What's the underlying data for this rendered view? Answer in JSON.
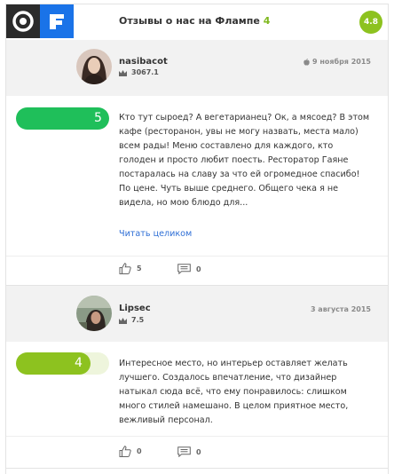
{
  "header": {
    "title": "Отзывы о нас на Флампе",
    "count": "4",
    "rating": "4.8"
  },
  "reviews": [
    {
      "author": "nasibacot",
      "karma": "3067.1",
      "date": "9 ноября 2015",
      "date_icon": "apple-icon",
      "score": "5",
      "score_fraction": 1.0,
      "score_color": "#1fbf5a",
      "text": "Кто тут сыроед? А вегетарианец? Ок, а мясоед? В этом кафе (ресторанон, увы не могу назвать, места мало) всем рады! Меню составлено для каждого, кто голоден и просто любит поесть. Ресторатор Гаяне постаралась на славу за что ей огромедное спасибо! По цене. Чуть выше среднего. Общего чека я не видела, но мою блюдо для...",
      "read_more": "Читать целиком",
      "likes": "5",
      "comments": "0"
    },
    {
      "author": "Lipsec",
      "karma": "7.5",
      "date": "3 августа 2015",
      "score": "4",
      "score_fraction": 0.8,
      "score_color": "#8dc21f",
      "text": "Интересное место, но интерьер оставляет желать лучшего. Создалось впечатление, что дизайнер натыкал сюда всё, что ему понравилось: слишком много стилей намешано. В целом приятное место, вежливый персонал.",
      "likes": "0",
      "comments": "0"
    }
  ],
  "colors": {
    "brand_dark": "#2b2b2b",
    "brand_blue": "#1a73e8",
    "accent_green": "#8dc21f",
    "link": "#2f6fd6"
  },
  "icons": {
    "logo_left": "flamp-target-icon",
    "logo_right": "flamp-f-icon",
    "like": "thumbs-up-icon",
    "comment": "speech-bubble-icon",
    "karma": "crown-icon"
  }
}
